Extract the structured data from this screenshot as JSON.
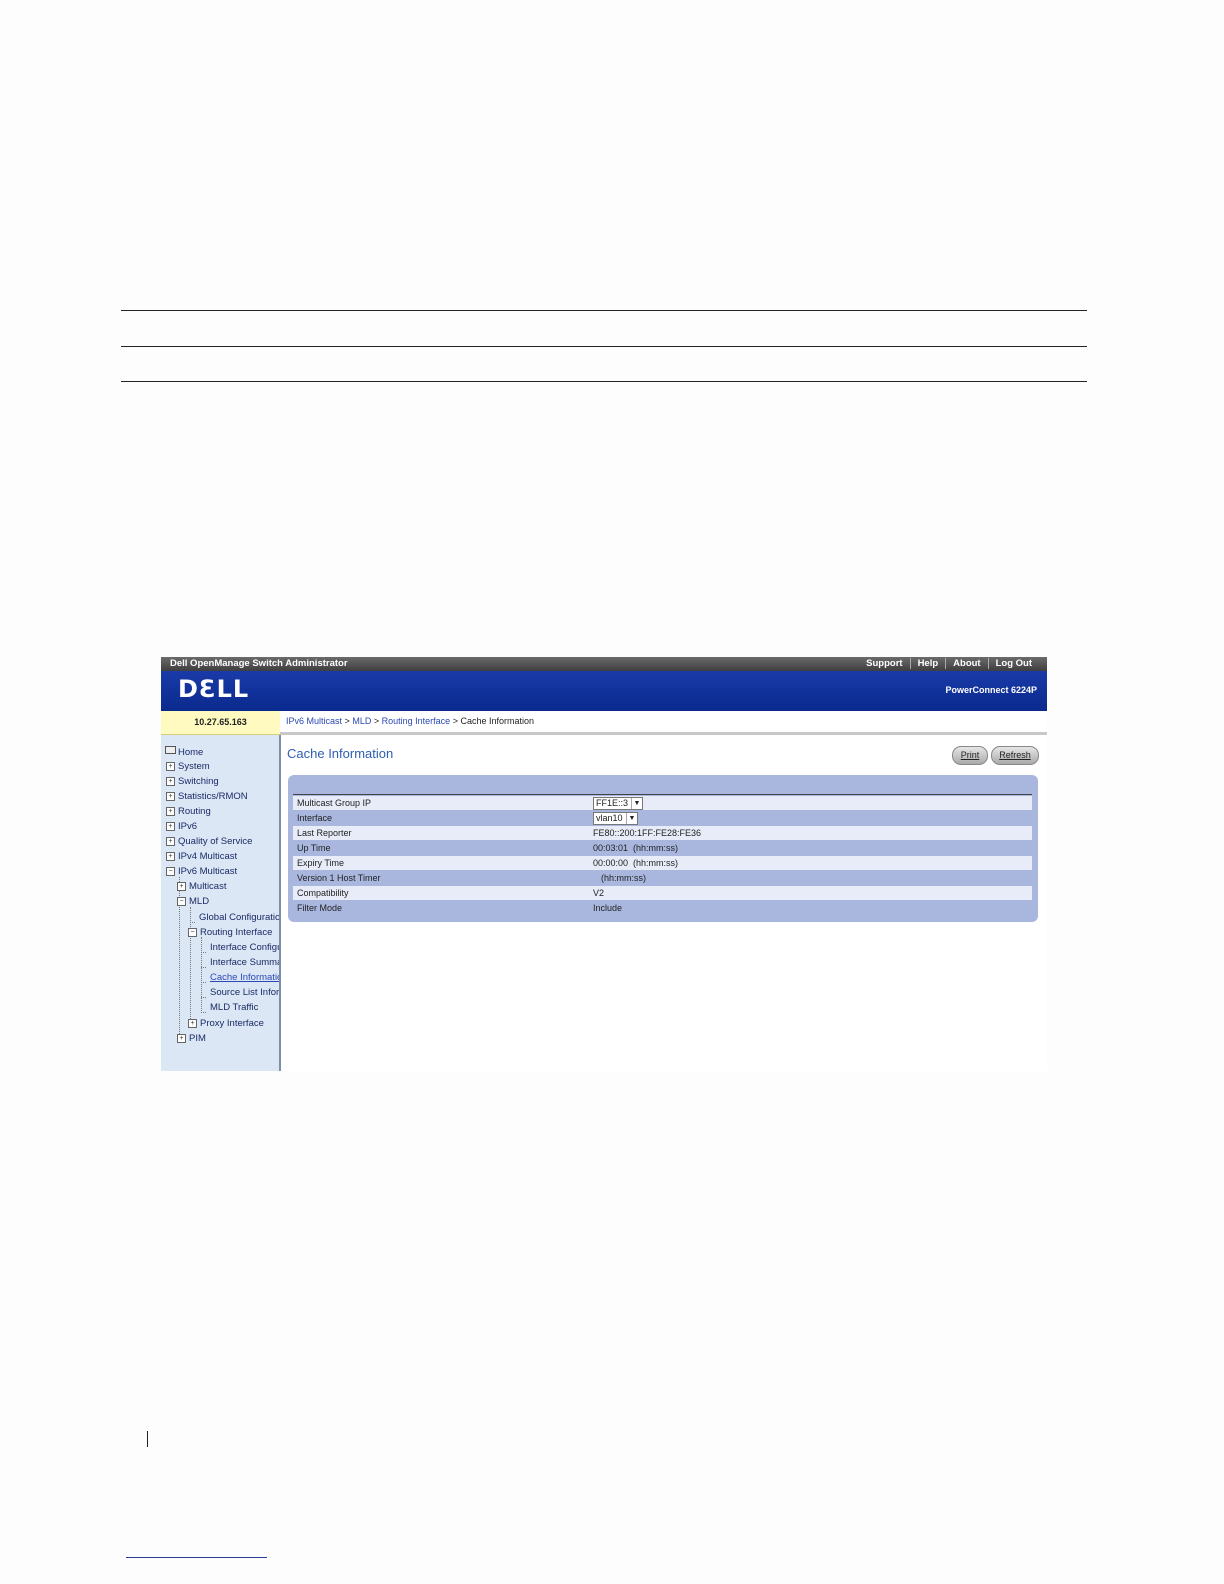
{
  "top_bar": {
    "app_title": "Dell OpenManage Switch Administrator",
    "links": [
      "Support",
      "Help",
      "About",
      "Log Out"
    ]
  },
  "header": {
    "logo": "DƐLL",
    "product": "PowerConnect 6224P"
  },
  "ip_address": "10.27.65.163",
  "breadcrumb": {
    "links": [
      "IPv6 Multicast",
      "MLD",
      "Routing Interface"
    ],
    "separator": ">",
    "current": "Cache Information"
  },
  "sidebar": {
    "items": [
      {
        "label": "Home",
        "icon": "monitor-icon"
      },
      {
        "label": "System",
        "icon": "expand-icon"
      },
      {
        "label": "Switching",
        "icon": "expand-icon"
      },
      {
        "label": "Statistics/RMON",
        "icon": "expand-icon"
      },
      {
        "label": "Routing",
        "icon": "expand-icon"
      },
      {
        "label": "IPv6",
        "icon": "expand-icon"
      },
      {
        "label": "Quality of Service",
        "icon": "expand-icon"
      },
      {
        "label": "IPv4 Multicast",
        "icon": "expand-icon"
      },
      {
        "label": "IPv6 Multicast",
        "icon": "collapse-icon"
      },
      {
        "label": "Multicast",
        "icon": "expand-icon"
      },
      {
        "label": "MLD",
        "icon": "collapse-icon"
      },
      {
        "label": "Global Configuration",
        "icon": ""
      },
      {
        "label": "Routing Interface",
        "icon": "collapse-icon"
      },
      {
        "label": "Interface Configuration",
        "icon": ""
      },
      {
        "label": "Interface Summary",
        "icon": ""
      },
      {
        "label": "Cache Information",
        "icon": ""
      },
      {
        "label": "Source List Information",
        "icon": ""
      },
      {
        "label": "MLD Traffic",
        "icon": ""
      },
      {
        "label": "Proxy Interface",
        "icon": "expand-icon"
      },
      {
        "label": "PIM",
        "icon": "expand-icon"
      }
    ]
  },
  "content": {
    "title": "Cache Information",
    "print_label": "Print",
    "refresh_label": "Refresh",
    "fields": [
      {
        "label": "Multicast Group IP",
        "value": "FF1E::3",
        "type": "select"
      },
      {
        "label": "Interface",
        "value": "vlan10",
        "type": "select"
      },
      {
        "label": "Last Reporter",
        "value": "FE80::200:1FF:FE28:FE36",
        "type": "text"
      },
      {
        "label": "Up Time",
        "value": "00:03:01  (hh:mm:ss)",
        "type": "text"
      },
      {
        "label": "Expiry Time",
        "value": "00:00:00  (hh:mm:ss)",
        "type": "text"
      },
      {
        "label": "Version 1 Host Timer",
        "value": "(hh:mm:ss)",
        "type": "text"
      },
      {
        "label": "Compatibility",
        "value": "V2",
        "type": "text"
      },
      {
        "label": "Filter Mode",
        "value": "Include",
        "type": "text"
      }
    ]
  },
  "colors": {
    "header_blue": "#0a2a8e",
    "sidebar_bg": "#dce7f5",
    "panel_bg": "#a9b7df",
    "link_blue": "#2b48b5",
    "title_blue": "#2f5faf"
  }
}
